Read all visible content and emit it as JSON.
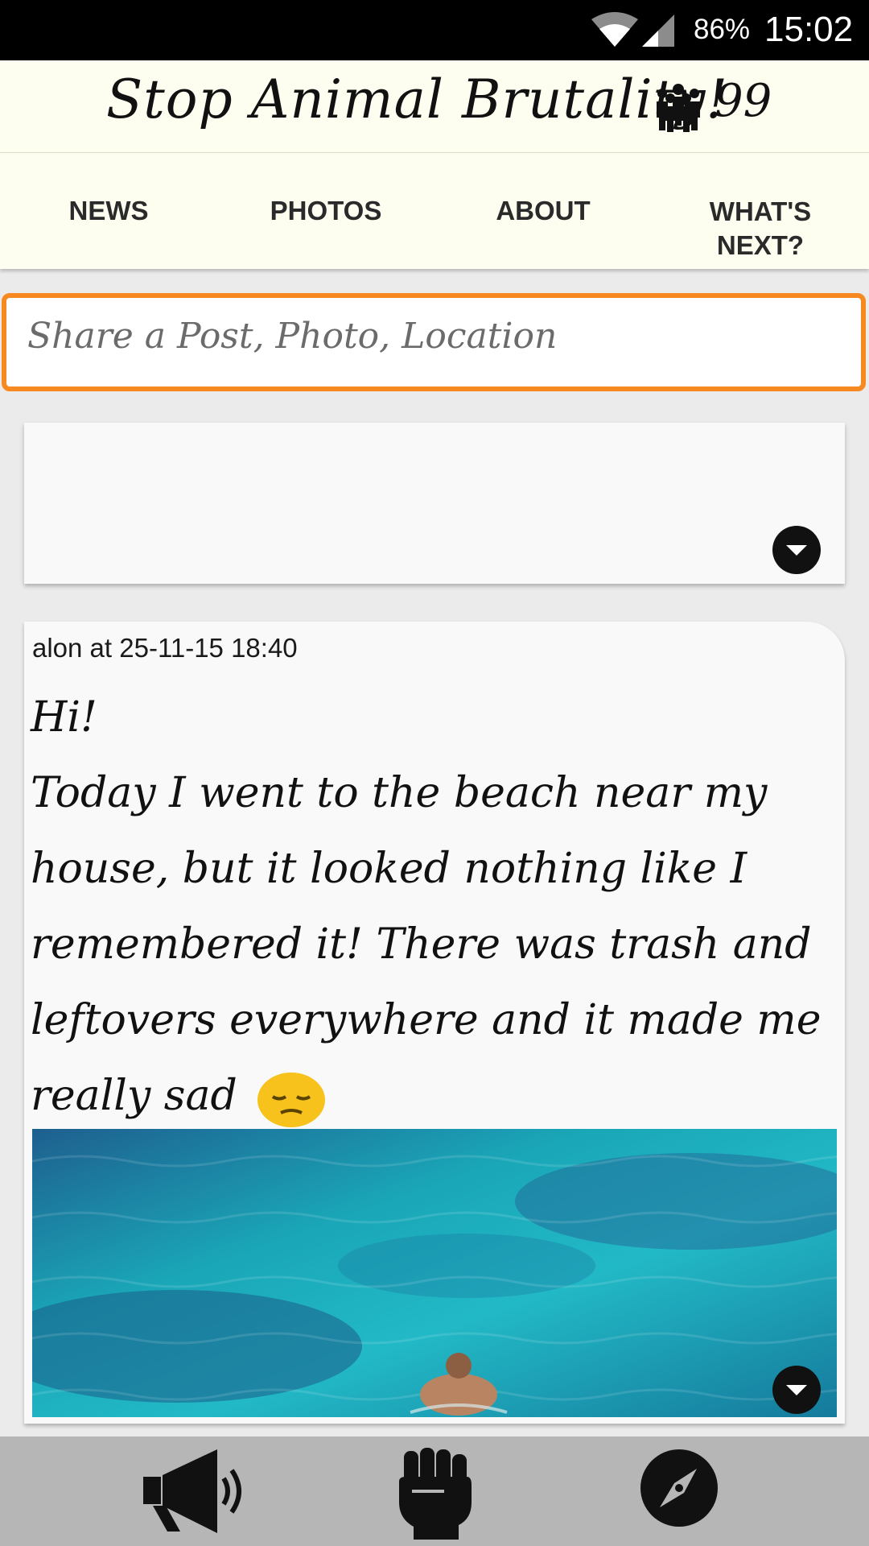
{
  "status_bar": {
    "battery": "86%",
    "time": "15:02",
    "icons": [
      "wifi-icon",
      "signal-icon"
    ]
  },
  "header": {
    "title": "Stop Animal Brutality!",
    "member_count": "99",
    "icon": "group-icon"
  },
  "tabs": [
    {
      "label": "NEWS"
    },
    {
      "label": "PHOTOS"
    },
    {
      "label": "ABOUT"
    },
    {
      "label": "WHAT'S NEXT?"
    }
  ],
  "share": {
    "placeholder": "Share a Post, Photo, Location"
  },
  "post": {
    "meta": "alon at 25-11-15 18:40",
    "text": "Hi!\nToday I went to the beach near my house, but it looked nothing like I remembered it! There was trash and leftovers everywhere and it made me really sad",
    "emoji": "pensive-face-emoji"
  },
  "bottom_nav": [
    {
      "icon": "megaphone-icon"
    },
    {
      "icon": "fist-icon"
    },
    {
      "icon": "compass-icon"
    }
  ],
  "colors": {
    "accent": "#f6891f",
    "header_bg": "#fefef0",
    "nav_bg": "#b6b6b6"
  }
}
